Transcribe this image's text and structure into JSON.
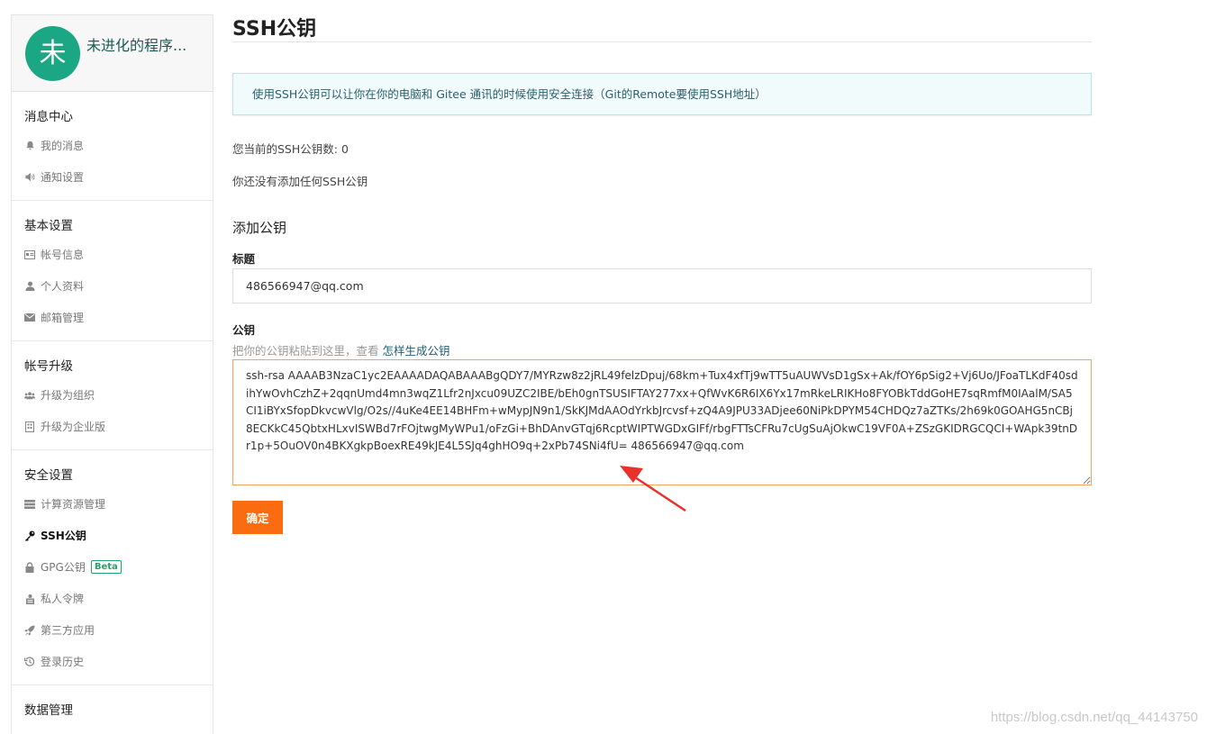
{
  "sidebar": {
    "avatar_text": "未",
    "username": "未进化的程序...",
    "sections": [
      {
        "title": "消息中心",
        "items": [
          {
            "label": "我的消息",
            "icon": "bell-icon"
          },
          {
            "label": "通知设置",
            "icon": "speaker-icon"
          }
        ]
      },
      {
        "title": "基本设置",
        "items": [
          {
            "label": "帐号信息",
            "icon": "id-card-icon"
          },
          {
            "label": "个人资料",
            "icon": "user-icon"
          },
          {
            "label": "邮箱管理",
            "icon": "envelope-icon"
          }
        ]
      },
      {
        "title": "帐号升级",
        "items": [
          {
            "label": "升级为组织",
            "icon": "users-icon"
          },
          {
            "label": "升级为企业版",
            "icon": "building-icon"
          }
        ]
      },
      {
        "title": "安全设置",
        "items": [
          {
            "label": "计算资源管理",
            "icon": "server-icon"
          },
          {
            "label": "SSH公钥",
            "icon": "key-icon",
            "active": true
          },
          {
            "label": "GPG公钥",
            "icon": "lock-icon",
            "badge": "Beta"
          },
          {
            "label": "私人令牌",
            "icon": "token-icon"
          },
          {
            "label": "第三方应用",
            "icon": "rocket-icon"
          },
          {
            "label": "登录历史",
            "icon": "history-icon"
          }
        ]
      },
      {
        "title": "数据管理",
        "items": []
      }
    ]
  },
  "main": {
    "title": "SSH公钥",
    "info": "使用SSH公钥可以让你在你的电脑和 Gitee 通讯的时候使用安全连接（Git的Remote要使用SSH地址）",
    "count_text": "您当前的SSH公钥数: 0",
    "empty_text": "你还没有添加任何SSH公钥",
    "add_title": "添加公钥",
    "title_label": "标题",
    "title_value": "486566947@qq.com",
    "key_label": "公钥",
    "key_hint": "把你的公钥粘贴到这里，查看",
    "key_hint_link": "怎样生成公钥",
    "key_value": "ssh-rsa AAAAB3NzaC1yc2EAAAADAQABAAABgQDY7/MYRzw8z2jRL49felzDpuj/68km+Tux4xfTj9wTT5uAUWVsD1gSx+Ak/fOY6pSig2+Vj6Uo/JFoaTLKdF40sdihYwOvhCzhZ+2qqnUmd4mn3wqZ1Lfr2nJxcu09UZC2IBE/bEh0gnTSUSIFTAY277xx+QfWvK6R6IX6Yx17mRkeLRIKHo8FYOBkTddGoHE7sqRmfM0IAalM/SA5CI1iBYxSfopDkvcwVlg/O2s//4uKe4EE14BHFm+wMypJN9n1/SkKJMdAAOdYrkbJrcvsf+zQ4A9JPU33ADjee60NiPkDPYM54CHDQz7aZTKs/2h69k0GOAHG5nCBj8ECKkC45QbtxHLxvISWBd7rFOjtwgMyWPu1/oFzGi+BhDAnvGTqj6RcptWIPTWGDxGIFf/rbgFTTsCFRu7cUgSuAjOkwC19VF0A+ZSzGKIDRGCQCI+WApk39tnDr1p+5OuOV0n4BKXgkpBoexRE49kJE4L5SJq4ghHO9q+2xPb74SNi4fU= 486566947@qq.com",
    "submit_label": "确定"
  },
  "watermark": "https://blog.csdn.net/qq_44143750",
  "colors": {
    "accent": "#fb6b0f",
    "avatar_bg": "#1ba784",
    "arrow": "#e8312a"
  }
}
